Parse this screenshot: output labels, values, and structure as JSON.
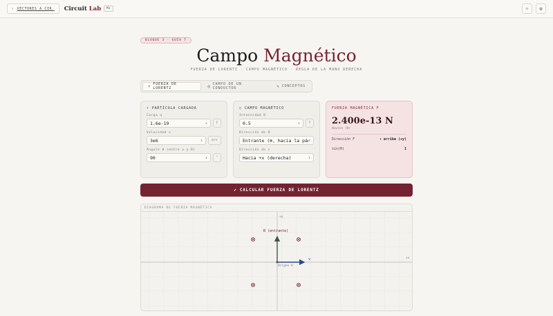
{
  "topbar": {
    "back_label": "VECTORES A CIR.",
    "brand_main": "Circuit",
    "brand_accent": "Lab",
    "brand_badge": "Mz",
    "theme_icon": "sun-icon",
    "settings_icon": "gear-icon"
  },
  "header": {
    "tag": "BLOQUE 3 · GUÍA 7",
    "title_main": "Campo ",
    "title_accent": "Magnético",
    "subtitle": "FUERZA DE LORENTZ · CAMPO MAGNÉTICO · REGLA DE LA MANO DERECHA"
  },
  "tabs": [
    {
      "label": "FUERZA DE LORENTZ",
      "icon": "⚡",
      "active": true
    },
    {
      "label": "CAMPO DE UN CONDUCTOR",
      "icon": "◎",
      "active": false
    },
    {
      "label": "CONCEPTOS",
      "icon": "✎",
      "active": false
    }
  ],
  "particle": {
    "title": "PARTÍCULA CARGADA",
    "charge_label": "Carga q",
    "charge_value": "1.6e-19",
    "charge_unit": "C",
    "velocity_label": "Velocidad v",
    "velocity_value": "3e6",
    "velocity_unit": "m/s",
    "angle_label": "Ángulo θ (entre v y B)",
    "angle_value": "90",
    "angle_unit": "°"
  },
  "field": {
    "title": "CAMPO MAGNÉTICO",
    "intensity_label": "Intensidad B",
    "intensity_value": "0.5",
    "intensity_unit": "T",
    "direction_label": "Dirección de B",
    "direction_value": "Entrante (⊗, hacia la página)",
    "v_direction_label": "Dirección de v",
    "v_direction_value": "Hacia +x (derecha)"
  },
  "result": {
    "title": "FUERZA MAGNÉTICA F",
    "value": "2.400e-13 N",
    "units": "Newton (N)",
    "direction_label": "Dirección F",
    "direction_value": "↑ arriba (+y)",
    "sin_label": "sin(θ)",
    "sin_value": "1"
  },
  "calc_button": {
    "icon": "✔",
    "label": "CALCULAR FUERZA DE LORENTZ"
  },
  "diagram": {
    "title": "DIAGRAMA DE FUERZA MAGNÉTICA",
    "y_axis_label": "+y",
    "x_axis_label": "+x",
    "b_label": "B (entrante)",
    "origin_label": "Origen O",
    "v_label": "v",
    "force_color": "#3d5a3d",
    "velocity_color": "#2b4a8a"
  }
}
